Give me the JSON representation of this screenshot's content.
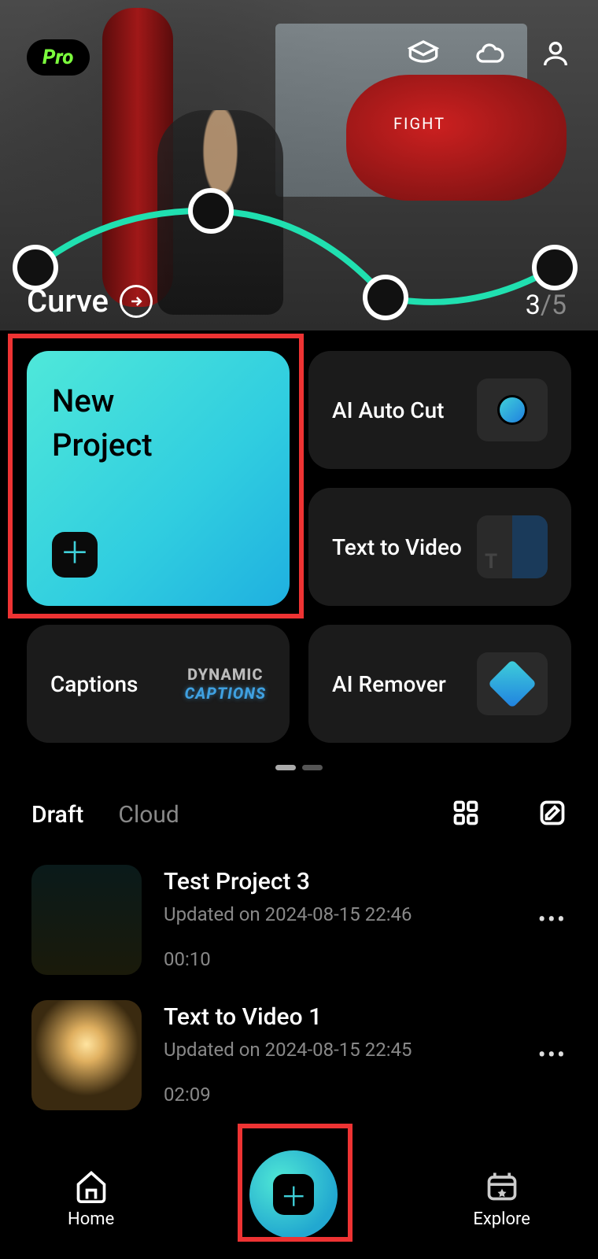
{
  "pro_label": "Pro",
  "hero": {
    "title": "Curve",
    "page_current": "3",
    "page_total": "/5"
  },
  "tiles": {
    "new_project": "New Project",
    "ai_auto_cut": "AI Auto Cut",
    "text_to_video": "Text to Video",
    "captions": "Captions",
    "captions_dyn1": "DYNAMIC",
    "captions_dyn2": "CAPTIONS",
    "ai_remover": "AI Remover"
  },
  "drafts": {
    "tab_draft": "Draft",
    "tab_cloud": "Cloud",
    "items": [
      {
        "title": "Test Project 3",
        "subtitle": "Updated on 2024-08-15 22:46",
        "duration": "00:10"
      },
      {
        "title": "Text to Video 1",
        "subtitle": "Updated on 2024-08-15 22:45",
        "duration": "02:09"
      }
    ]
  },
  "nav": {
    "home": "Home",
    "explore": "Explore"
  }
}
